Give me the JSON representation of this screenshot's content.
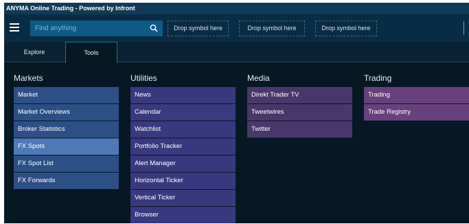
{
  "app": {
    "title": "ANYMA Online Trading - Powered by Infront"
  },
  "toolbar": {
    "search_placeholder": "Find anything",
    "drop_slots": [
      "Drop symbol here",
      "Drop symbol here",
      "Drop symbol here"
    ]
  },
  "tabs": [
    {
      "label": "Explore",
      "active": false
    },
    {
      "label": "Tools",
      "active": true
    }
  ],
  "colors": {
    "markets": "#2c4f86",
    "markets_selected": "#4e78b8",
    "utilities": "#38397f",
    "media": "#4a3769",
    "trading": "#69407c"
  },
  "categories": [
    {
      "title": "Markets",
      "items": [
        "Market",
        "Market Overviews",
        "Broker Statistics",
        "FX Spots",
        "FX Spot List",
        "FX Forwards"
      ],
      "selected_index": 3
    },
    {
      "title": "Utilities",
      "items": [
        "News",
        "Calendar",
        "Watchlist",
        "Portfolio Tracker",
        "Alert Manager",
        "Horizontal Ticker",
        "Vertical Ticker",
        "Browser"
      ]
    },
    {
      "title": "Media",
      "items": [
        "Direkt Trader TV",
        "Tweetwires",
        "Twitter"
      ]
    },
    {
      "title": "Trading",
      "items": [
        "Trading",
        "Trade Registry"
      ]
    }
  ]
}
